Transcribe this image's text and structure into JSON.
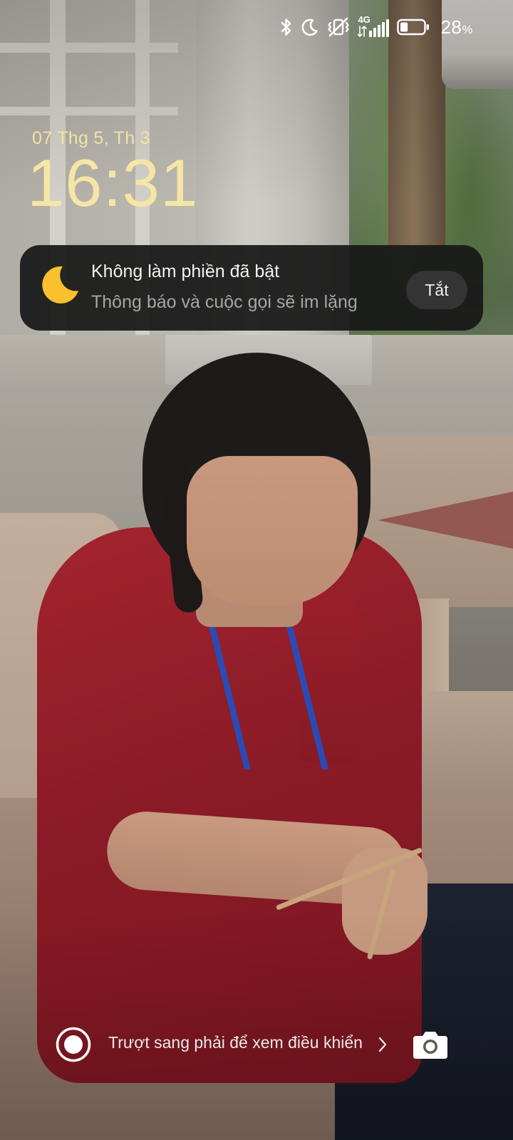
{
  "status_bar": {
    "network_type": "4G",
    "battery_level": "28",
    "battery_unit": "%",
    "battery_fill_fraction": 0.28,
    "icons": [
      "bluetooth-icon",
      "moon-icon",
      "vibrate-off-icon",
      "signal-icon",
      "battery-icon"
    ]
  },
  "lock_screen": {
    "date": "07 Thg 5, Th 3",
    "time": "16:31"
  },
  "dnd_banner": {
    "title": "Không làm phiền đã bật",
    "subtitle": "Thông báo và cuộc gọi sẽ im lặng",
    "button_label": "Tắt",
    "icon": "moon-icon",
    "icon_color": "#FBC02D"
  },
  "bottom_bar": {
    "swipe_hint": "Trượt sang phải để xem điều khiển",
    "left_icon": "record-icon",
    "right_icon": "camera-icon"
  },
  "colors": {
    "clock": "#F6E6A6",
    "banner_background": "#181818",
    "banner_button": "#343434"
  }
}
